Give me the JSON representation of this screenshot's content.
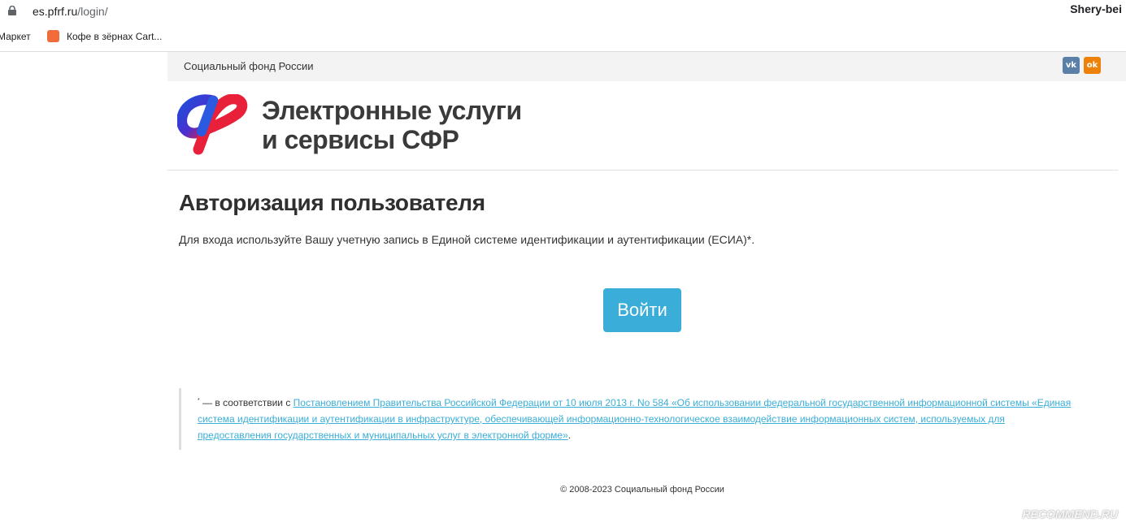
{
  "browser": {
    "url_host": "es.pfrf.ru",
    "url_path": "/login/",
    "profile_name": "Shery-bei",
    "bookmarks": [
      {
        "label": "Маркет"
      },
      {
        "label": "Кофе в зёрнах Cart..."
      }
    ]
  },
  "site": {
    "fund_name": "Социальный фонд России",
    "social": {
      "vk": "vk",
      "ok": "ok"
    },
    "title_line1": "Электронные услуги",
    "title_line2": "и сервисы СФР"
  },
  "main": {
    "page_title": "Авторизация пользователя",
    "intro": "Для входа используйте Вашу учетную запись в Единой системе идентификации и аутентификации (ЕСИА)*.",
    "login_label": "Войти",
    "note_prefix": " — в соответствии с ",
    "note_link": "Постановлением Правительства Российской Федерации от 10 июля 2013 г. No 584 «Об использовании федеральной государственной информационной системы «Единая система идентификации и аутентификации в инфраструктуре, обеспечивающей информационно-технологическое взаимодействие информационных систем, используемых для предоставления государственных и муниципальных услуг в электронной форме»",
    "note_suffix": ".",
    "note_asterisk": "*"
  },
  "footer": {
    "copyright": "© 2008-2023 Социальный фонд России"
  },
  "watermark": "RECOMMEND.RU",
  "colors": {
    "accent": "#3aaed8",
    "vk": "#5b7fa6",
    "ok": "#ee8208"
  }
}
